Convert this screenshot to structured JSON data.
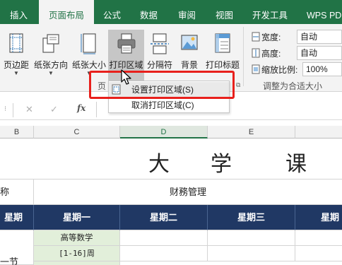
{
  "tabs": {
    "insert": "插入",
    "page_layout": "页面布局",
    "formulas": "公式",
    "data": "数据",
    "review": "审阅",
    "view": "视图",
    "developer": "开发工具",
    "wps_pdf": "WPS PDF"
  },
  "ribbon": {
    "margins": "页边距",
    "orientation": "纸张方向",
    "size": "纸张大小",
    "print_area": "打印区域",
    "breaks": "分隔符",
    "background": "背景",
    "print_titles": "打印标题",
    "group_label_partial": "页",
    "scale_to_fit": {
      "width_label": "宽度:",
      "width_value": "自动",
      "height_label": "高度:",
      "height_value": "自动",
      "scale_label": "缩放比例:",
      "scale_value": "100%",
      "group_label": "调整为合适大小"
    }
  },
  "dropdown": {
    "set_print_area": "设置打印区域(S)",
    "clear_print_area": "取消打印区域(C)"
  },
  "formula_bar": {
    "cancel_glyph": "✕",
    "enter_glyph": "✓",
    "fx_glyph": "fx"
  },
  "columns": [
    "B",
    "C",
    "D",
    "E"
  ],
  "sheet": {
    "title": [
      "大",
      "学",
      "课"
    ],
    "name_cell_partial": "称",
    "dept": "财務管理",
    "weekday_partial": "星期",
    "weekdays": [
      "星期一",
      "星期二",
      "星期三",
      "星期"
    ],
    "course_name": "高等数学",
    "course_weeks": "[1-16]周",
    "row_label_partial": "一节"
  },
  "colors": {
    "excel_green": "#217346",
    "header_navy": "#203864",
    "course_green": "#e2efda",
    "highlight_red": "#e8201c"
  }
}
